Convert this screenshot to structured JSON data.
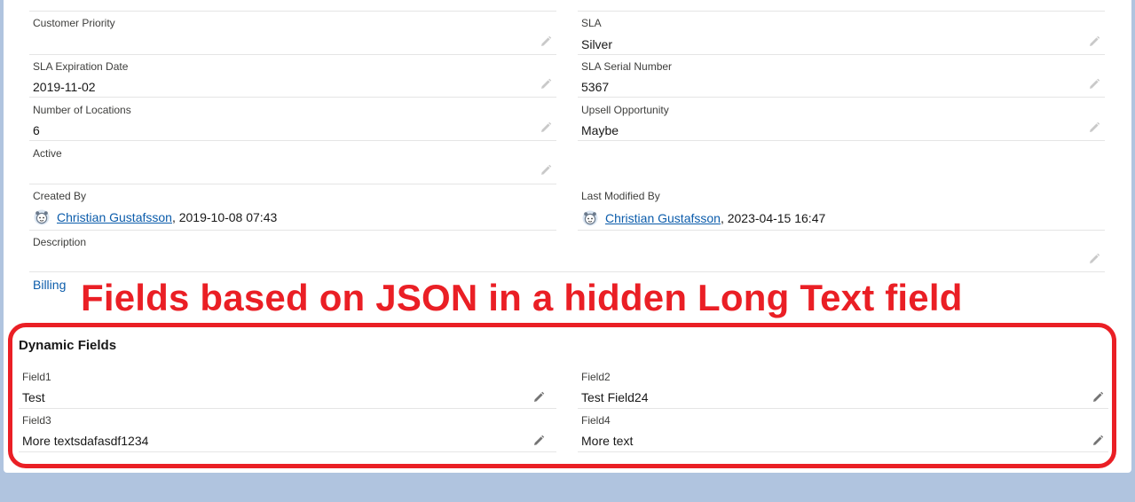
{
  "fields": {
    "customer_priority": {
      "label": "Customer Priority",
      "value": ""
    },
    "sla": {
      "label": "SLA",
      "value": "Silver"
    },
    "sla_expiration_date": {
      "label": "SLA Expiration Date",
      "value": "2019-11-02"
    },
    "sla_serial_number": {
      "label": "SLA Serial Number",
      "value": "5367"
    },
    "number_of_locations": {
      "label": "Number of Locations",
      "value": "6"
    },
    "upsell_opportunity": {
      "label": "Upsell Opportunity",
      "value": "Maybe"
    },
    "active": {
      "label": "Active",
      "value": ""
    },
    "created_by": {
      "label": "Created By",
      "user": "Christian Gustafsson",
      "date": ", 2019-10-08 07:43"
    },
    "last_modified_by": {
      "label": "Last Modified By",
      "user": "Christian Gustafsson",
      "date": ", 2023-04-15 16:47"
    },
    "description": {
      "label": "Description",
      "value": ""
    }
  },
  "billing_link": "Billing",
  "annotation": "Fields based on JSON in a hidden Long Text field",
  "dynamic": {
    "title": "Dynamic Fields",
    "field1": {
      "label": "Field1",
      "value": "Test"
    },
    "field2": {
      "label": "Field2",
      "value": "Test Field24"
    },
    "field3": {
      "label": "Field3",
      "value": "More textsdafasdf1234"
    },
    "field4": {
      "label": "Field4",
      "value": "More text"
    }
  },
  "colors": {
    "link": "#0b5cab",
    "annotation": "#ea1f25",
    "background": "#b0c4df"
  },
  "icons": {
    "edit": "pencil-icon",
    "user": "user-avatar-icon"
  }
}
